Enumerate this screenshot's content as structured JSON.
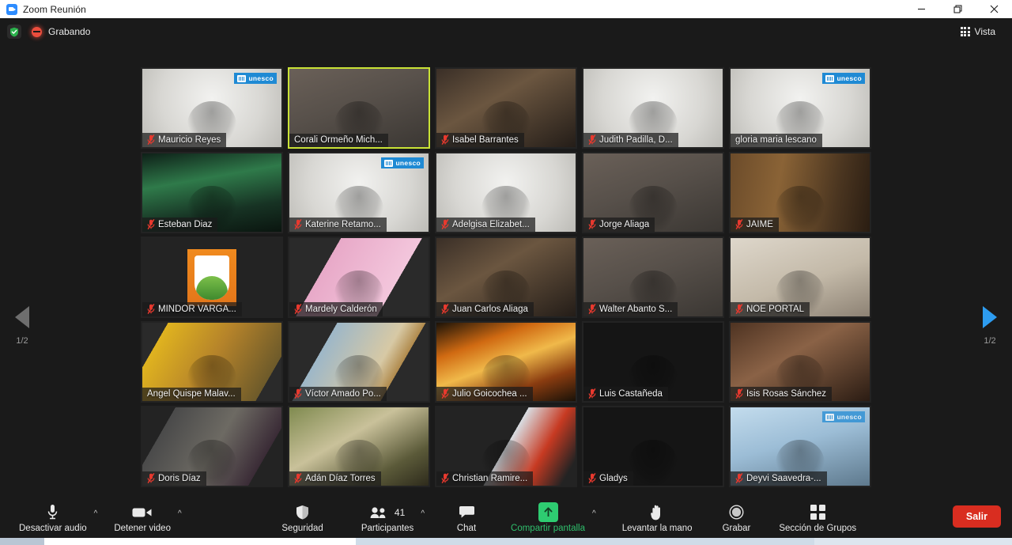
{
  "window": {
    "title": "Zoom Reunión",
    "app_icon": "zoom-camera-icon",
    "minimize": "minimize-icon",
    "maximize": "restore-icon",
    "close": "close-icon"
  },
  "header": {
    "shield_icon": "shield-check-icon",
    "recording_icon": "recording-dot-icon",
    "recording_label": "Grabando",
    "view_icon": "grid-view-icon",
    "view_label": "Vista"
  },
  "gallery": {
    "prev_arrow_icon": "chevron-left-icon",
    "prev_page_label": "1/2",
    "next_arrow_icon": "chevron-right-icon",
    "next_page_label": "1/2",
    "active_border_color": "#c9e236",
    "muted_icon_color": "#e8392e",
    "participants": [
      {
        "name": "Mauricio Reyes",
        "muted": true,
        "active": false,
        "badge": "unesco",
        "bg": "light"
      },
      {
        "name": "Corali Ormeño Mich...",
        "muted": false,
        "active": true,
        "badge": "",
        "bg": "room"
      },
      {
        "name": "Isabel Barrantes",
        "muted": true,
        "active": false,
        "badge": "",
        "bg": "dark-room"
      },
      {
        "name": "Judith Padilla, D...",
        "muted": true,
        "active": false,
        "badge": "",
        "bg": "light"
      },
      {
        "name": "gloria maria lescano",
        "muted": false,
        "active": false,
        "badge": "unesco",
        "bg": "light"
      },
      {
        "name": "Esteban Diaz",
        "muted": true,
        "active": false,
        "badge": "",
        "bg": "aurora"
      },
      {
        "name": "Katerine Retamo...",
        "muted": true,
        "active": false,
        "badge": "unesco",
        "bg": "light"
      },
      {
        "name": "Adelgisa Elizabet...",
        "muted": true,
        "active": false,
        "badge": "",
        "bg": "light"
      },
      {
        "name": "Jorge Aliaga",
        "muted": true,
        "active": false,
        "badge": "",
        "bg": "room"
      },
      {
        "name": "JAIME",
        "muted": true,
        "active": false,
        "badge": "",
        "bg": "shelf"
      },
      {
        "name": "MINDOR VARGA...",
        "muted": true,
        "active": false,
        "badge": "",
        "bg": "logo"
      },
      {
        "name": "Mardely Calderón",
        "muted": true,
        "active": false,
        "badge": "",
        "bg": "pink"
      },
      {
        "name": "Juan Carlos Aliaga",
        "muted": true,
        "active": false,
        "badge": "",
        "bg": "dark-room"
      },
      {
        "name": "Walter Abanto S...",
        "muted": true,
        "active": false,
        "badge": "",
        "bg": "room"
      },
      {
        "name": "NOÉ PORTAL",
        "muted": true,
        "active": false,
        "badge": "",
        "bg": "wall"
      },
      {
        "name": "Angel Quispe Malav...",
        "muted": false,
        "active": false,
        "badge": "",
        "bg": "yellow"
      },
      {
        "name": "Víctor Amado Po...",
        "muted": true,
        "active": false,
        "badge": "",
        "bg": "poster"
      },
      {
        "name": "Julio Goicochea ...",
        "muted": true,
        "active": false,
        "badge": "",
        "bg": "patria"
      },
      {
        "name": "Luis Castañeda",
        "muted": true,
        "active": false,
        "badge": "",
        "bg": "black"
      },
      {
        "name": "Isis Rosas Sánchez",
        "muted": true,
        "active": false,
        "badge": "",
        "bg": "brown"
      },
      {
        "name": "Doris Díaz",
        "muted": true,
        "active": false,
        "badge": "",
        "bg": "dim"
      },
      {
        "name": "Adán Díaz Torres",
        "muted": true,
        "active": false,
        "badge": "",
        "bg": "green"
      },
      {
        "name": "Christian Ramire...",
        "muted": true,
        "active": false,
        "badge": "",
        "bg": "red"
      },
      {
        "name": "Gladys",
        "muted": true,
        "active": false,
        "badge": "",
        "bg": "black"
      },
      {
        "name": "Deyvi Saavedra-...",
        "muted": true,
        "active": false,
        "badge": "unesco",
        "bg": "blue"
      }
    ]
  },
  "toolbar": {
    "mute_icon": "microphone-icon",
    "mute_label": "Desactivar audio",
    "mute_caret": "chevron-up-icon",
    "video_icon": "camera-icon",
    "video_label": "Detener video",
    "video_caret": "chevron-up-icon",
    "security_icon": "shield-icon",
    "security_label": "Seguridad",
    "participants_icon": "people-icon",
    "participants_count": "41",
    "participants_label": "Participantes",
    "participants_caret": "chevron-up-icon",
    "chat_icon": "chat-bubble-icon",
    "chat_label": "Chat",
    "share_icon": "share-screen-arrow-icon",
    "share_label": "Compartir pantalla",
    "share_caret": "chevron-up-icon",
    "share_color": "#2fbf6c",
    "hand_icon": "raise-hand-icon",
    "hand_label": "Levantar la mano",
    "record_icon": "record-circle-icon",
    "record_label": "Grabar",
    "breakout_icon": "breakout-rooms-icon",
    "breakout_label": "Sección de Grupos",
    "leave_label": "Salir",
    "leave_color": "#d92d20"
  }
}
